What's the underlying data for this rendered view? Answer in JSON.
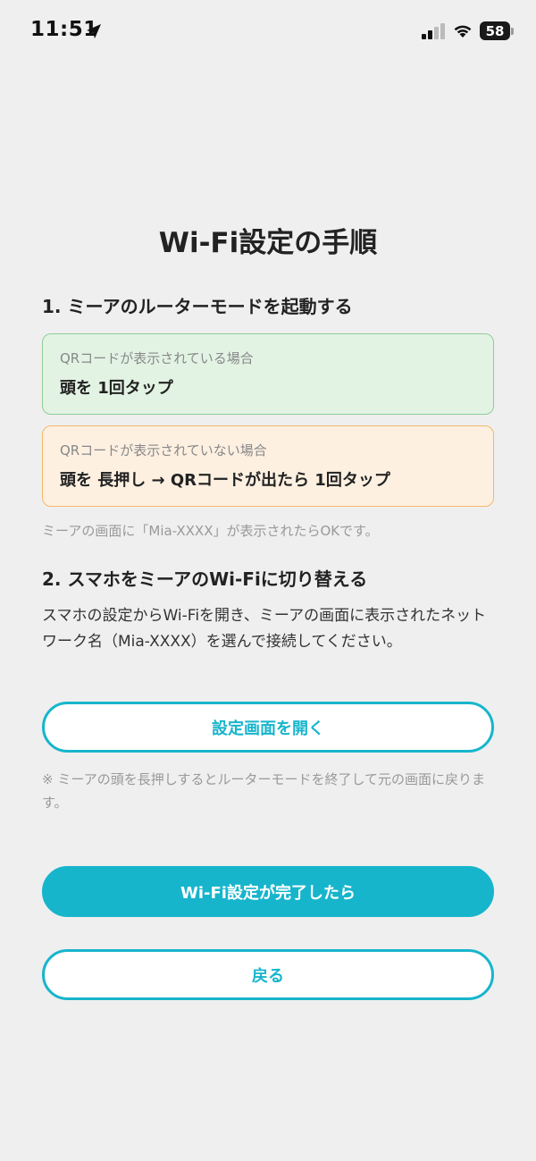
{
  "status_bar": {
    "time": "11:51",
    "battery": "58"
  },
  "title": "Wi-Fi設定の手順",
  "step1": {
    "heading": "1. ミーアのルーターモードを起動する",
    "card_qr_shown": {
      "condition": "QRコードが表示されている場合",
      "action": "頭を 1回タップ"
    },
    "card_qr_not_shown": {
      "condition": "QRコードが表示されていない場合",
      "action": "頭を 長押し → QRコードが出たら 1回タップ"
    },
    "note": "ミーアの画面に「Mia-XXXX」が表示されたらOKです。"
  },
  "step2": {
    "heading": "2. スマホをミーアのWi-Fiに切り替える",
    "description": "スマホの設定からWi-Fiを開き、ミーアの画面に表示されたネットワーク名（Mia-XXXX）を選んで接続してください。",
    "open_settings_button": "設定画面を開く",
    "note": "※ ミーアの頭を長押しするとルーターモードを終了して元の画面に戻ります。"
  },
  "buttons": {
    "done": "Wi-Fi設定が完了したら",
    "back": "戻る"
  },
  "colors": {
    "accent": "#17b5cc",
    "card_green_bg": "#e2f3e4",
    "card_green_border": "#8fcd96",
    "card_orange_bg": "#fdf0e1",
    "card_orange_border": "#f4b868",
    "background": "#efefef"
  }
}
